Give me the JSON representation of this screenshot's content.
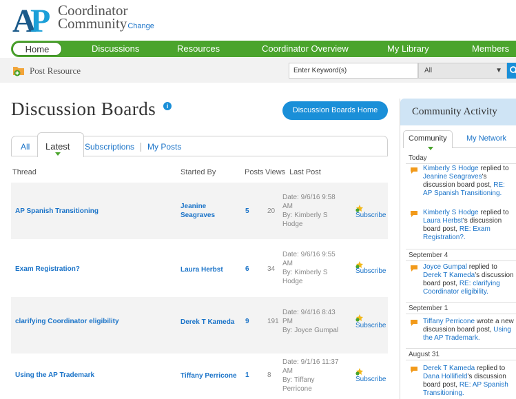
{
  "header": {
    "logo_text": "AP",
    "brand_line1": "Coordinator",
    "brand_line2": "Community",
    "change_link": "Change"
  },
  "nav": {
    "items": [
      "Home",
      "Discussions",
      "Resources",
      "Coordinator Overview",
      "My Library",
      "Members"
    ]
  },
  "toolbar": {
    "post_resource": "Post Resource",
    "search_placeholder": "Enter Keyword(s)",
    "filter_value": "All"
  },
  "main": {
    "title": "Discussion Boards",
    "home_button": "Discussion Boards Home",
    "tabs": [
      "All",
      "Latest",
      "Subscriptions",
      "My Posts"
    ],
    "active_tab": "Latest",
    "columns": [
      "Thread",
      "Started By",
      "Posts",
      "Views",
      "Last Post"
    ],
    "rows": [
      {
        "thread": "AP Spanish Transitioning",
        "starter1": "Jeanine",
        "starter2": "Seagraves",
        "posts": "5",
        "views": "20",
        "lp1": "Date: 9/6/16 9:58",
        "lp2": "AM",
        "lp3": "By: Kimberly S",
        "lp4": "Hodge",
        "subscribe": "Subscribe"
      },
      {
        "thread": "Exam Registration?",
        "starter1": "Laura Herbst",
        "starter2": "",
        "posts": "6",
        "views": "34",
        "lp1": "Date: 9/6/16 9:55",
        "lp2": "AM",
        "lp3": "By: Kimberly S",
        "lp4": "Hodge",
        "subscribe": "Subscribe"
      },
      {
        "thread": "clarifying Coordinator eligibility",
        "starter1": "Derek T Kameda",
        "starter2": "",
        "posts": "9",
        "views": "191",
        "lp1": "Date: 9/4/16 8:43",
        "lp2": "PM",
        "lp3": "By: Joyce Gumpal",
        "lp4": "",
        "subscribe": "Subscribe"
      },
      {
        "thread": "Using the AP Trademark",
        "starter1": "Tiffany Perricone",
        "starter2": "",
        "posts": "1",
        "views": "8",
        "lp1": "Date: 9/1/16 11:37",
        "lp2": "AM",
        "lp3": "By: Tiffany",
        "lp4": "Perricone",
        "subscribe": "Subscribe"
      }
    ]
  },
  "sidebar": {
    "title": "Community Activity",
    "tabs": [
      "Community",
      "My Network"
    ],
    "groups": [
      {
        "day": "Today"
      },
      {
        "day": "September 4"
      },
      {
        "day": "September 1"
      },
      {
        "day": "August 31"
      }
    ],
    "activities": [
      {
        "actor": "Kimberly S Hodge",
        "t1": " replied to",
        "target": "Jeanine Seagraves",
        "t2": "'s discussion board post, ",
        "post": "RE: AP Spanish Transitioning."
      },
      {
        "actor": "Kimberly S Hodge",
        "t1": " replied to",
        "target": "Laura Herbst",
        "t2": "'s discussion board post, ",
        "post": "RE: Exam Registration?."
      },
      {
        "actor": "Joyce Gumpal",
        "t1": " replied to",
        "target": "Derek T Kameda",
        "t2": "'s discussion board post, ",
        "post": "RE: clarifying Coordinator eligibility."
      },
      {
        "actor": "Tiffany Perricone",
        "t1": " wrote a new discussion board post, ",
        "target": "",
        "t2": "",
        "post": "Using the AP Trademark."
      },
      {
        "actor": "Derek T Kameda",
        "t1": " replied to",
        "target": "Dana Hollifield",
        "t2": "'s discussion board post, ",
        "post": "RE: AP Spanish Transitioning."
      }
    ]
  },
  "colors": {
    "nav_green": "#4aa42c",
    "link_blue": "#1a73c8",
    "button_blue": "#1a8fd8",
    "sidebar_head": "#cfe4f5"
  }
}
